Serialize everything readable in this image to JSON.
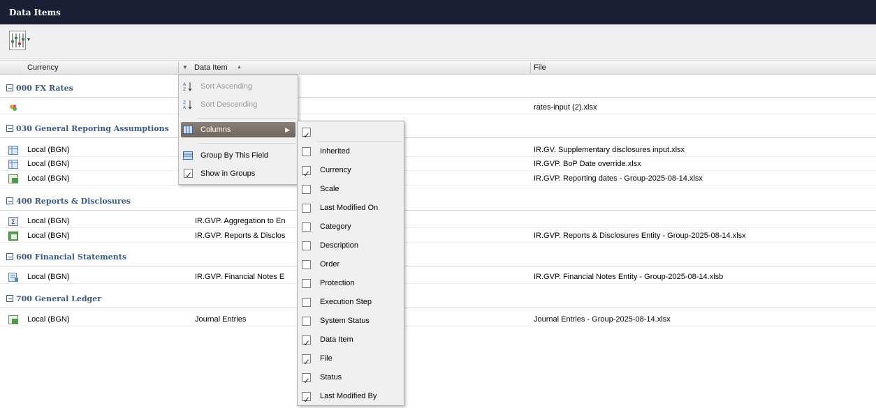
{
  "window": {
    "title": "Data Items"
  },
  "toolbar": {
    "icon": "column-chooser-icon",
    "caret": "▾"
  },
  "columns": {
    "currency": "Currency",
    "data_item": "Data Item",
    "sort_indicator": "▲",
    "filter_caret": "▼",
    "file": "File"
  },
  "groups": [
    {
      "title": "000 FX Rates"
    },
    {
      "title": "030 General Reporing Assumptions"
    },
    {
      "title": "400 Reports & Disclosures"
    },
    {
      "title": "600 Financial Statements"
    },
    {
      "title": "700 General Ledger"
    }
  ],
  "rows": [
    {
      "currency": "",
      "data_item": "",
      "file": "rates-input (2).xlsx",
      "icon": "fx-rates-icon"
    },
    {
      "currency": "Local (BGN)",
      "data_item": "",
      "file": "IR.GV. Supplementary disclosures input.xlsx",
      "icon": "grid-icon"
    },
    {
      "currency": "Local (BGN)",
      "data_item": "",
      "file": "IR.GVP. BoP Date override.xlsx",
      "icon": "grid-icon"
    },
    {
      "currency": "Local (BGN)",
      "data_item": "",
      "file": "IR.GVP. Reporting dates - Group-2025-08-14.xlsx",
      "icon": "spreadsheet-icon"
    },
    {
      "currency": "Local (BGN)",
      "data_item": "IR.GVP. Aggregation to En",
      "file": "",
      "icon": "sum-icon"
    },
    {
      "currency": "Local (BGN)",
      "data_item": "IR.GVP. Reports & Disclos",
      "file": "IR.GVP. Reports & Disclosures Entity - Group-2025-08-14.xlsx",
      "icon": "spreadsheet-icon"
    },
    {
      "currency": "Local (BGN)",
      "data_item": "IR.GVP. Financial Notes E",
      "file": "IR.GVP. Financial Notes Entity - Group-2025-08-14.xlsb",
      "icon": "notes-icon"
    },
    {
      "currency": "Local (BGN)",
      "data_item": "Journal Entries",
      "file": "Journal Entries - Group-2025-08-14.xlsx",
      "icon": "spreadsheet-icon"
    }
  ],
  "context_menu": {
    "sort_ascending": "Sort Ascending",
    "sort_descending": "Sort Descending",
    "columns": "Columns",
    "group_by": "Group By This Field",
    "show_in_groups": "Show in Groups",
    "show_in_groups_checked": true
  },
  "columns_menu": [
    {
      "label": "",
      "checked": true
    },
    {
      "label": "Inherited",
      "checked": false
    },
    {
      "label": "Currency",
      "checked": true
    },
    {
      "label": "Scale",
      "checked": false
    },
    {
      "label": "Last Modified On",
      "checked": false
    },
    {
      "label": "Category",
      "checked": false
    },
    {
      "label": "Description",
      "checked": false
    },
    {
      "label": "Order",
      "checked": false
    },
    {
      "label": "Protection",
      "checked": false
    },
    {
      "label": "Execution Step",
      "checked": false
    },
    {
      "label": "System Status",
      "checked": false
    },
    {
      "label": "Data Item",
      "checked": true
    },
    {
      "label": "File",
      "checked": true
    },
    {
      "label": "Status",
      "checked": true
    },
    {
      "label": "Last Modified By",
      "checked": true
    }
  ],
  "colors": {
    "titlebar": "#1a1f36",
    "group_title": "#3a5a86",
    "menu_active": "#7a7068"
  }
}
